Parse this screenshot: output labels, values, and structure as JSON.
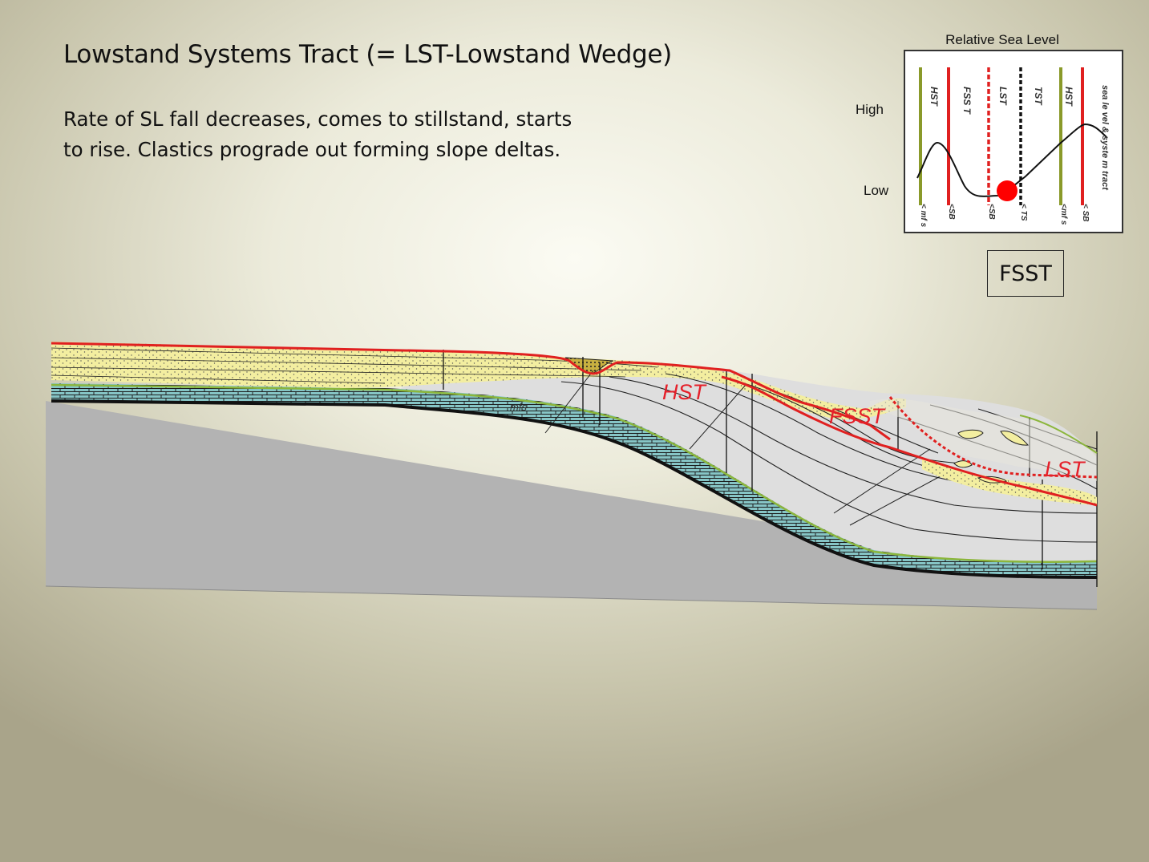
{
  "slide": {
    "title": "Lowstand Systems Tract  (= LST-Lowstand Wedge)",
    "body_lines": [
      "Rate of SL fall decreases, comes to stillstand, starts",
      "to rise.  Clastics prograde out forming slope deltas."
    ]
  },
  "sea_level_chart": {
    "title": "Relative Sea Level",
    "y_high_label": "High",
    "y_low_label": "Low",
    "columns": [
      {
        "tract": "HST",
        "surface": "< mf s",
        "line_color": "#8a9a2a",
        "style": "solid"
      },
      {
        "tract": "FSS T",
        "surface": "<SB",
        "line_color": "#e02020",
        "style": "solid"
      },
      {
        "tract": "LST",
        "surface": "<SB",
        "line_color": "#e02020",
        "style": "dashed"
      },
      {
        "tract": "TST",
        "surface": "< TS",
        "line_color": "#111111",
        "style": "dashed"
      },
      {
        "tract": "HST",
        "surface": "<mf s",
        "line_color": "#8a9a2a",
        "style": "solid"
      },
      {
        "tract": "sea le vel & syste m tract",
        "surface": "< SB",
        "line_color": "#e02020",
        "style": "solid"
      }
    ],
    "marker_color": "#ff0000",
    "marker_stage": "LST"
  },
  "stage_badge": "FSST",
  "cross_section": {
    "tract_labels": {
      "hst": "HST",
      "fsst": "FSST",
      "lst": "LST"
    },
    "surface_label": "mfs",
    "colors": {
      "sand": "#f3eea0",
      "basement": "#b3b3b3",
      "carbonate": "#86c5c6",
      "shale": "#dcdcdc",
      "sequence_boundary": "#e02020",
      "mfs_line": "#8cb63c"
    }
  }
}
